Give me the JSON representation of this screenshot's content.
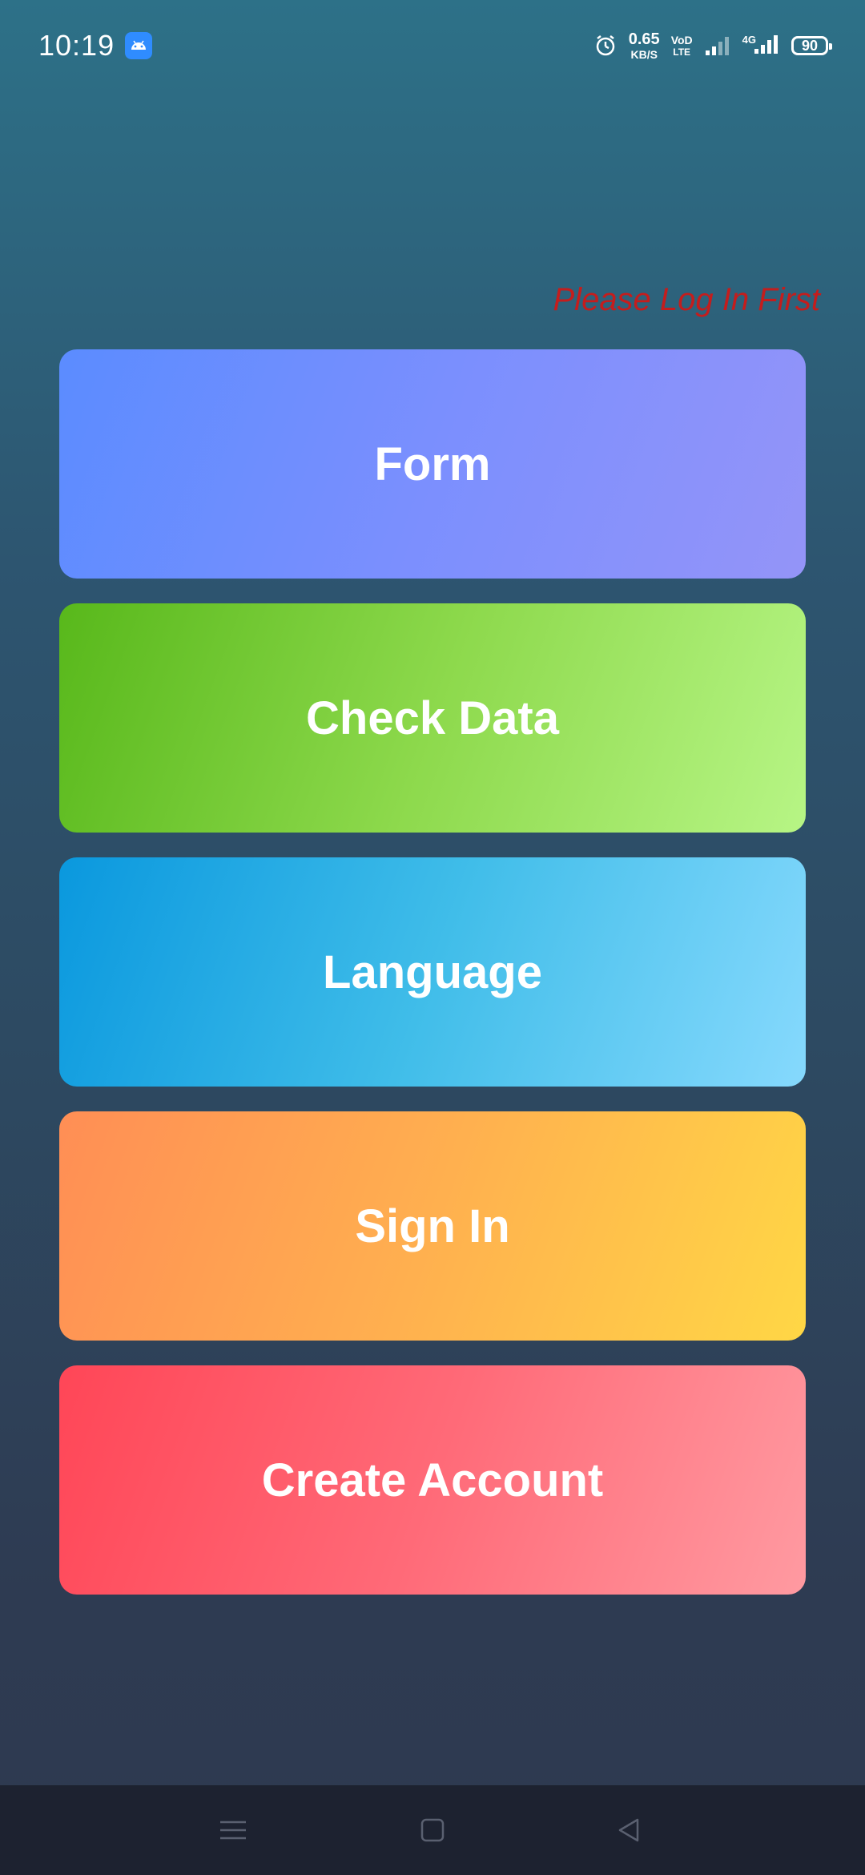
{
  "status_bar": {
    "time": "10:19",
    "network_speed_value": "0.65",
    "network_speed_unit": "KB/S",
    "volte_top": "VoD",
    "volte_bottom": "LTE",
    "network_type": "4G",
    "battery_level": "90"
  },
  "notice": {
    "text": "Please Log In First",
    "color": "#c41d1d"
  },
  "menu": {
    "items": [
      {
        "label": "Form"
      },
      {
        "label": "Check Data"
      },
      {
        "label": "Language"
      },
      {
        "label": "Sign In"
      },
      {
        "label": "Create Account"
      }
    ]
  },
  "nav_bar": {
    "icons": [
      "menu-icon",
      "home-icon",
      "back-icon"
    ]
  }
}
